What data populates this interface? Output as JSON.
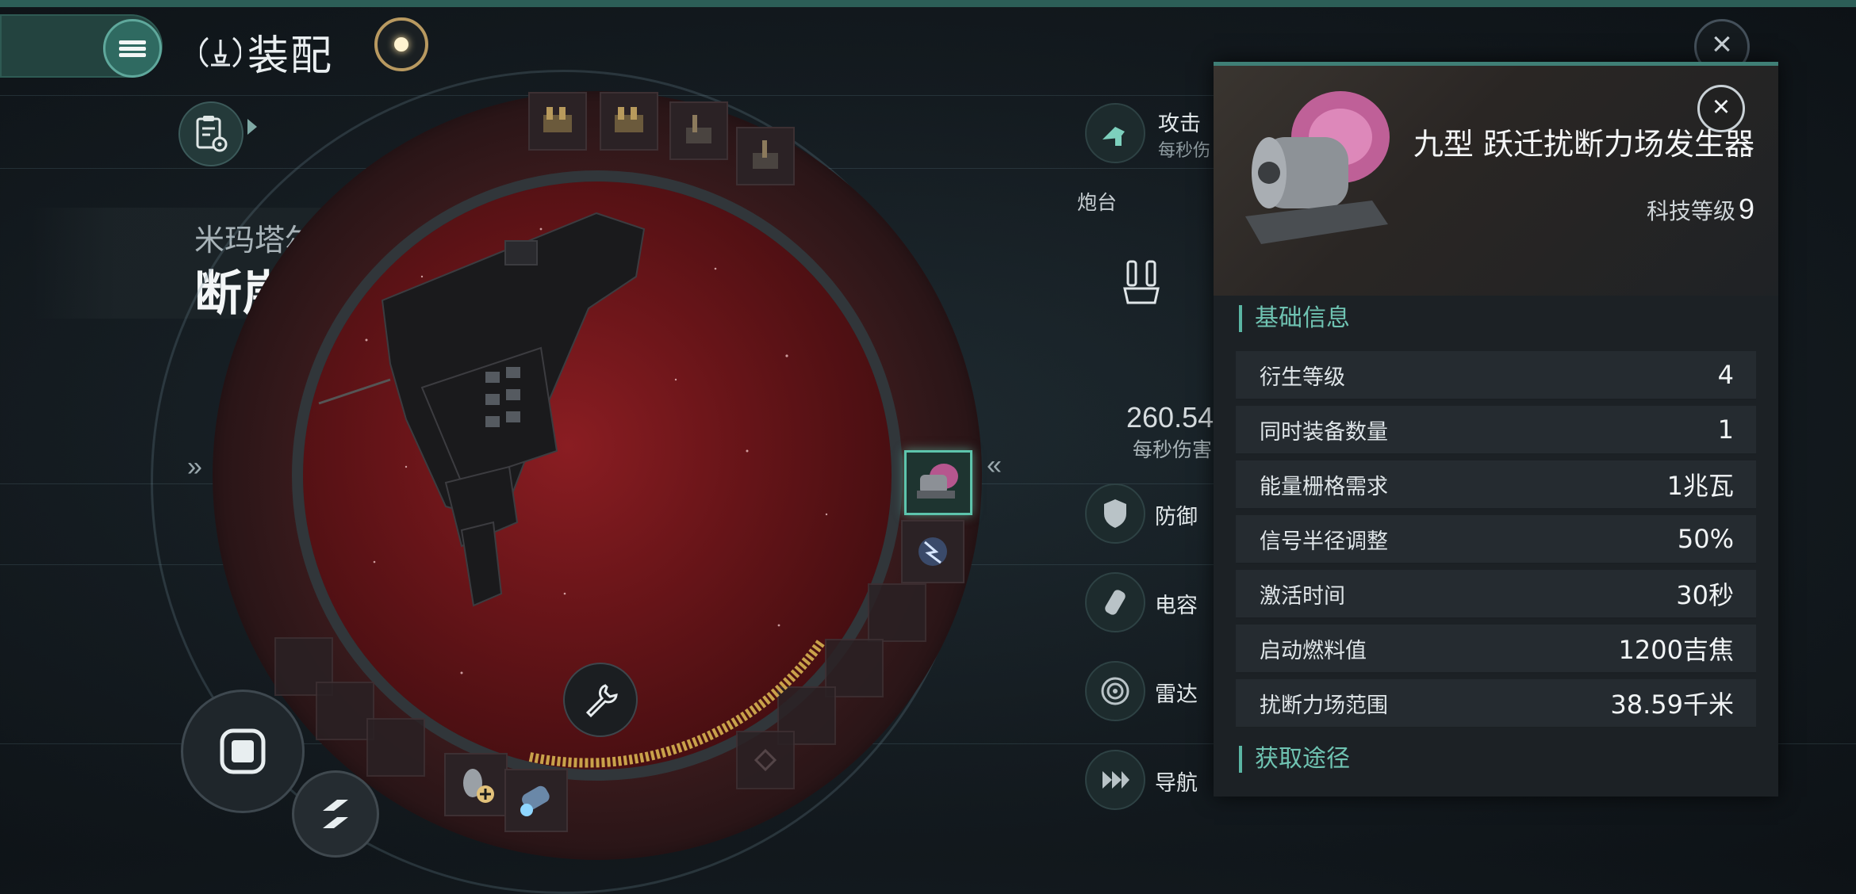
{
  "header": {
    "title": "装配"
  },
  "ship": {
    "faction": "米玛塔尔",
    "name": "断崖级拦截型",
    "name_arrow": "»"
  },
  "ring": {
    "left_chevron": "»",
    "right_chevron": "«"
  },
  "stats": {
    "attack_label": "攻击",
    "attack_sub": "每秒伤",
    "turret_label": "炮台",
    "dps_value": "260.54",
    "dps_unit": "每秒伤害",
    "defense_label": "防御",
    "capacitor_label": "电容",
    "radar_label": "雷达",
    "navigation_label": "导航"
  },
  "panel": {
    "close_glyph": "×",
    "item_name": "九型 跃迁扰断力场发生器",
    "tech_level_label": "科技等级",
    "tech_level_value": "9",
    "basic_info_title": "基础信息",
    "rows": [
      {
        "label": "衍生等级",
        "value": "4"
      },
      {
        "label": "同时装备数量",
        "value": "1"
      },
      {
        "label": "能量栅格需求",
        "value": "1兆瓦"
      },
      {
        "label": "信号半径调整",
        "value": "50%"
      },
      {
        "label": "激活时间",
        "value": "30秒"
      },
      {
        "label": "启动燃料值",
        "value": "1200吉焦"
      },
      {
        "label": "扰断力场范围",
        "value": "38.59千米"
      }
    ],
    "acquire_title": "获取途径"
  },
  "top_close_glyph": "×",
  "colors": {
    "accent": "#5dc4ac",
    "panel_bg": "#1c2125",
    "space_red": "#8a1d22"
  },
  "icons": [
    "menu-icon",
    "fitting-icon",
    "target-icon",
    "close-icon",
    "clipboard-settings-icon",
    "wrench-icon",
    "stop-icon",
    "swap-icon",
    "attack-icon",
    "turret-icon",
    "shield-icon",
    "capacitor-icon",
    "radar-icon",
    "navigation-icon"
  ]
}
